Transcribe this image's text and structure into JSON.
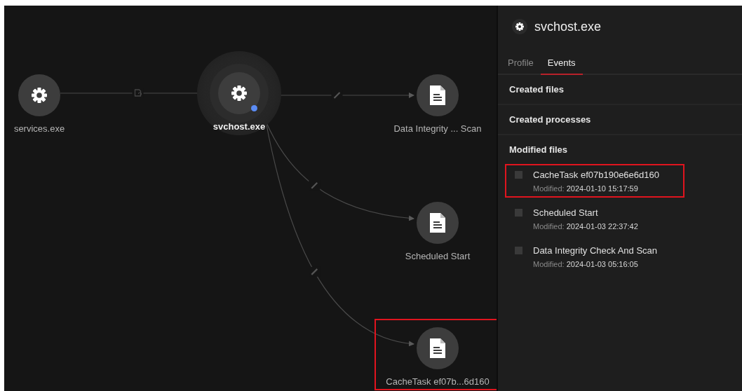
{
  "graph": {
    "nodes": [
      {
        "kind": "process",
        "label": "services.exe",
        "selected": false,
        "highlighted": false
      },
      {
        "kind": "process",
        "label": "svchost.exe",
        "selected": true,
        "highlighted": false
      },
      {
        "kind": "file",
        "label": "Data Integrity ... Scan",
        "selected": false,
        "highlighted": false
      },
      {
        "kind": "file",
        "label": "Scheduled Start",
        "selected": false,
        "highlighted": false
      },
      {
        "kind": "file",
        "label": "CacheTask ef07b...6d160",
        "selected": false,
        "highlighted": true
      }
    ],
    "edges": [
      {
        "kind": "cycle"
      },
      {
        "kind": "modify"
      },
      {
        "kind": "modify"
      },
      {
        "kind": "modify"
      }
    ]
  },
  "panel": {
    "title": "svchost.exe",
    "tabs": [
      {
        "label": "Profile",
        "selected": false
      },
      {
        "label": "Events",
        "selected": true
      }
    ],
    "sections": [
      {
        "title": "Created files"
      },
      {
        "title": "Created processes"
      },
      {
        "title": "Modified files",
        "items": [
          {
            "name": "CacheTask ef07b190e6e6d160",
            "date_label": "Modified:",
            "date": "2024-01-10 15:17:59",
            "checked": false,
            "highlighted": true
          },
          {
            "name": "Scheduled Start",
            "date_label": "Modified:",
            "date": "2024-01-03 22:37:42",
            "checked": false,
            "highlighted": false
          },
          {
            "name": "Data Integrity Check And Scan",
            "date_label": "Modified:",
            "date": "2024-01-03 05:16:05",
            "checked": false,
            "highlighted": false
          }
        ]
      }
    ]
  }
}
